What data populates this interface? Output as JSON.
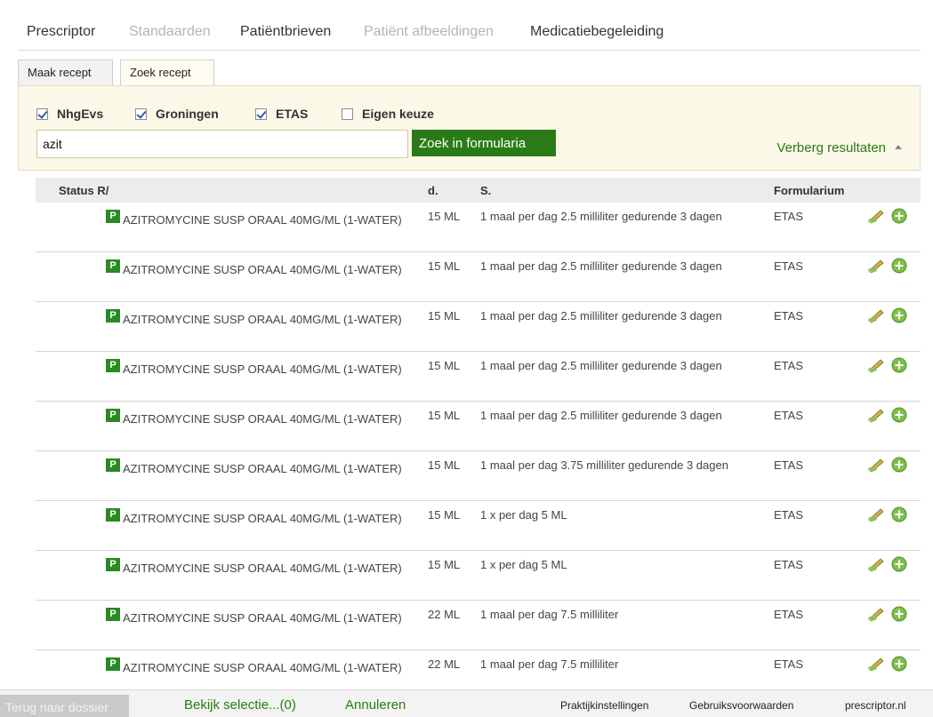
{
  "nav": {
    "items": [
      {
        "label": "Prescriptor",
        "state": "active"
      },
      {
        "label": "Standaarden",
        "state": "disabled"
      },
      {
        "label": "Patiëntbrieven",
        "state": "active"
      },
      {
        "label": "Patiënt afbeeldingen",
        "state": "disabled"
      },
      {
        "label": "Medicatiebegeleiding",
        "state": "active"
      }
    ]
  },
  "tabs": {
    "make": "Maak recept",
    "search": "Zoek recept"
  },
  "search": {
    "filters": [
      {
        "label": "NhgEvs",
        "checked": true
      },
      {
        "label": "Groningen",
        "checked": true
      },
      {
        "label": "ETAS",
        "checked": true
      },
      {
        "label": "Eigen keuze",
        "checked": false
      }
    ],
    "query": "azit",
    "button_label": "Zoek in formularia",
    "toggle_label": "Verberg resultaten"
  },
  "table": {
    "headers": {
      "status": "Status R/",
      "dose": "d.",
      "sig": "S.",
      "formulary": "Formularium"
    },
    "status_badge": "P",
    "rows": [
      {
        "name": "AZITROMYCINE SUSP ORAAL 40MG/ML (1-WATER)",
        "dose": "15 ML",
        "sig": "1 maal per dag 2.5 milliliter gedurende 3 dagen",
        "formulary": "ETAS"
      },
      {
        "name": "AZITROMYCINE SUSP ORAAL 40MG/ML (1-WATER)",
        "dose": "15 ML",
        "sig": "1 maal per dag 2.5 milliliter gedurende 3 dagen",
        "formulary": "ETAS"
      },
      {
        "name": "AZITROMYCINE SUSP ORAAL 40MG/ML (1-WATER)",
        "dose": "15 ML",
        "sig": "1 maal per dag 2.5 milliliter gedurende 3 dagen",
        "formulary": "ETAS"
      },
      {
        "name": "AZITROMYCINE SUSP ORAAL 40MG/ML (1-WATER)",
        "dose": "15 ML",
        "sig": "1 maal per dag 2.5 milliliter gedurende 3 dagen",
        "formulary": "ETAS"
      },
      {
        "name": "AZITROMYCINE SUSP ORAAL 40MG/ML (1-WATER)",
        "dose": "15 ML",
        "sig": "1 maal per dag 2.5 milliliter gedurende 3 dagen",
        "formulary": "ETAS"
      },
      {
        "name": "AZITROMYCINE SUSP ORAAL 40MG/ML (1-WATER)",
        "dose": "15 ML",
        "sig": "1 maal per dag 3.75 milliliter gedurende 3 dagen",
        "formulary": "ETAS"
      },
      {
        "name": "AZITROMYCINE SUSP ORAAL 40MG/ML (1-WATER)",
        "dose": "15 ML",
        "sig": "1 x per dag 5 ML",
        "formulary": "ETAS"
      },
      {
        "name": "AZITROMYCINE SUSP ORAAL 40MG/ML (1-WATER)",
        "dose": "15 ML",
        "sig": "1 x per dag 5 ML",
        "formulary": "ETAS"
      },
      {
        "name": "AZITROMYCINE SUSP ORAAL 40MG/ML (1-WATER)",
        "dose": "22 ML",
        "sig": "1 maal per dag 7.5 milliliter",
        "formulary": "ETAS"
      },
      {
        "name": "AZITROMYCINE SUSP ORAAL 40MG/ML (1-WATER)",
        "dose": "22 ML",
        "sig": "1 maal per dag 7.5 milliliter",
        "formulary": "ETAS"
      }
    ]
  },
  "footer": {
    "back": "Terug naar dossier",
    "view_selection": "Bekijk selectie...(0)",
    "cancel": "Annuleren",
    "practice_settings": "Praktijkinstellingen",
    "terms": "Gebruiksvoorwaarden",
    "site": "prescriptor.nl"
  },
  "colors": {
    "accent_green": "#2a7b17",
    "badge_green": "#2a8a22",
    "panel_bg": "#fbf8e8"
  },
  "icons": {
    "edit": "pencil-edit-icon",
    "add": "plus-circle-icon",
    "toggle": "triangle-up-icon"
  }
}
